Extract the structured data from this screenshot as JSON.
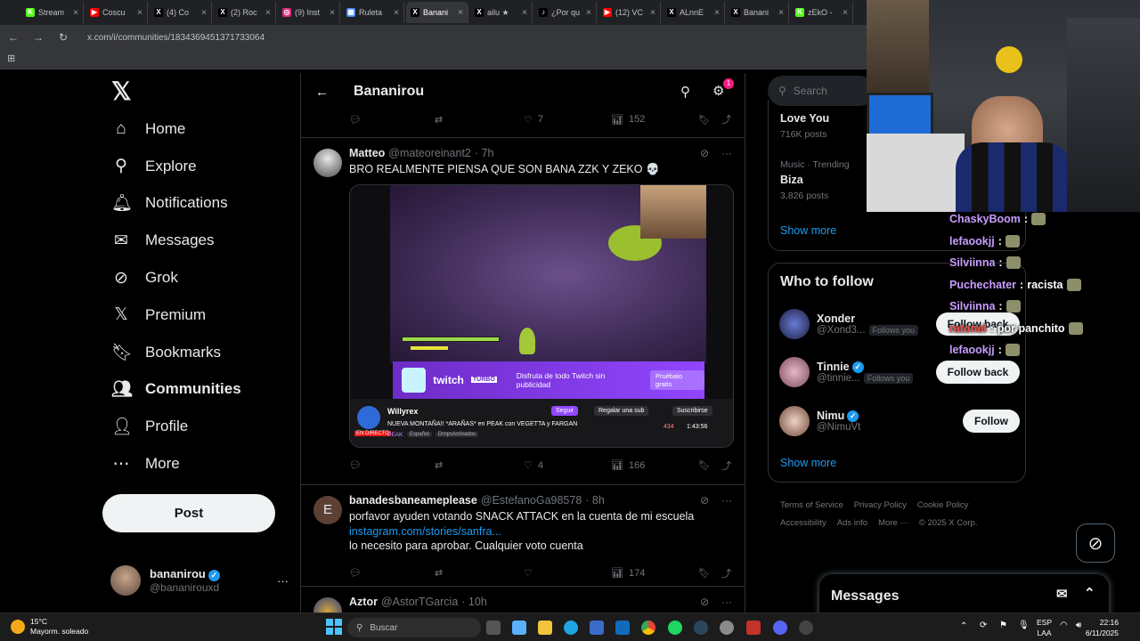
{
  "browser": {
    "tabs": [
      {
        "title": "Stream",
        "color": "#53fc18",
        "glyph": "K"
      },
      {
        "title": "Coscu",
        "color": "#ff0000",
        "glyph": "▶"
      },
      {
        "title": "(4) Co",
        "color": "#000000",
        "glyph": "X"
      },
      {
        "title": "(2) Roc",
        "color": "#000000",
        "glyph": "X"
      },
      {
        "title": "(9) Inst",
        "color": "#d62976",
        "glyph": "◎"
      },
      {
        "title": "Ruleta",
        "color": "#4285f4",
        "glyph": "▦"
      },
      {
        "title": "Banani",
        "color": "#000000",
        "glyph": "X"
      },
      {
        "title": "ailu ★",
        "color": "#000000",
        "glyph": "X"
      },
      {
        "title": "¿Por qu",
        "color": "#000000",
        "glyph": "♪"
      },
      {
        "title": "(12) VC",
        "color": "#ff0000",
        "glyph": "▶"
      },
      {
        "title": "ALnnE",
        "color": "#000000",
        "glyph": "X"
      },
      {
        "title": "Banani",
        "color": "#000000",
        "glyph": "X"
      },
      {
        "title": "zEkO -",
        "color": "#53fc18",
        "glyph": "K"
      }
    ],
    "active_tab_index": 6,
    "url": "x.com/i/communities/1834369451371733064"
  },
  "nav": {
    "logo": "𝕏",
    "items": [
      {
        "label": "Home",
        "icon": "⌂"
      },
      {
        "label": "Explore",
        "icon": "⚲"
      },
      {
        "label": "Notifications",
        "icon": "🔔︎"
      },
      {
        "label": "Messages",
        "icon": "✉"
      },
      {
        "label": "Grok",
        "icon": "⊘"
      },
      {
        "label": "Premium",
        "icon": "𝕏"
      },
      {
        "label": "Bookmarks",
        "icon": "🔖︎"
      },
      {
        "label": "Communities",
        "icon": "👥︎"
      },
      {
        "label": "Profile",
        "icon": "👤︎"
      },
      {
        "label": "More",
        "icon": "⋯"
      }
    ],
    "post_label": "Post",
    "account": {
      "name": "bananirou",
      "handle": "@bananirouxd"
    }
  },
  "header": {
    "title": "Bananirou",
    "back_icon": "←",
    "settings_badge": "1"
  },
  "top_actions": {
    "likes": "7",
    "views": "152"
  },
  "tweets": [
    {
      "name": "Matteo",
      "handle": "@mateoreinant2",
      "time": "· 7h",
      "text": "BRO REALMENTE PIENSA QUE SON BANA ZZK Y ZEKO 💀",
      "likes": "4",
      "views": "166",
      "media": {
        "twitch_brand": "twitch",
        "twitch_sub": "TURBO",
        "ad_text": "Disfruta de todo Twitch sin publicidad",
        "ad_button": "Pruébalo gratis",
        "channel": "Willyrex",
        "stream_title": "NUEVA MONTAÑA!! *ARAÑAS* en PEAK con VEGETTA y FARGAN",
        "live_label": "EN DIRECTO",
        "game": "PEAK",
        "tags": [
          "Español",
          "DropsActivados"
        ],
        "follow": "Seguir",
        "gift": "Regalar una sub",
        "subscribe": "Suscribirse",
        "viewers": "434",
        "uptime": "1:43:56"
      }
    },
    {
      "name": "banadesbaneameplease",
      "handle": "@EstefanoGa98578",
      "time": "· 8h",
      "avatar_letter": "E",
      "text1": "porfavor ayuden votando SNACK ATTACK en la cuenta de mi escuela",
      "link": "instagram.com/stories/sanfra...",
      "text2": "lo necesito para aprobar. Cualquier voto cuenta",
      "views": "174"
    },
    {
      "name": "Aztor",
      "handle": "@AstorTGarcia",
      "time": "· 10h"
    }
  ],
  "right": {
    "search_placeholder": "Search",
    "trends": [
      {
        "title": "Love You",
        "posts": "716K posts"
      },
      {
        "category": "Music · Trending",
        "title": "Biza",
        "posts": "3,826 posts"
      }
    ],
    "show_more": "Show more",
    "who_to_follow": {
      "title": "Who to follow",
      "people": [
        {
          "name": "Xonder",
          "handle": "@Xond3...",
          "follows_you": "Follows you",
          "button": "Follow back"
        },
        {
          "name": "Tinnie",
          "handle": "@tinnie...",
          "follows_you": "Follows you",
          "button": "Follow back"
        },
        {
          "name": "Nimu",
          "handle": "@NimuVt",
          "follows_you": "",
          "button": "Follow"
        }
      ],
      "show_more": "Show more"
    },
    "footer": [
      "Terms of Service",
      "Privacy Policy",
      "Cookie Policy",
      "Accessibility",
      "Ads info",
      "More ···",
      "© 2025 X Corp."
    ]
  },
  "messages_drawer": {
    "title": "Messages"
  },
  "chat": [
    {
      "user": "ChaskyBoom",
      "msg": "",
      "red": false
    },
    {
      "user": "lefaookjj",
      "msg": "",
      "red": false
    },
    {
      "user": "Silviinna",
      "msg": "",
      "red": false
    },
    {
      "user": "Puchechater",
      "msg": "racista",
      "red": false
    },
    {
      "user": "Silviinna",
      "msg": "",
      "red": false
    },
    {
      "user": "ratonel",
      "msg": "por panchito",
      "red": true
    },
    {
      "user": "lefaookjj",
      "msg": "",
      "red": false
    }
  ],
  "taskbar": {
    "temp": "15°C",
    "weather": "Mayorm. soleado",
    "search": "Buscar",
    "lang1": "ESP",
    "lang2": "LAA",
    "time": "22:16",
    "date": "6/11/2025"
  }
}
